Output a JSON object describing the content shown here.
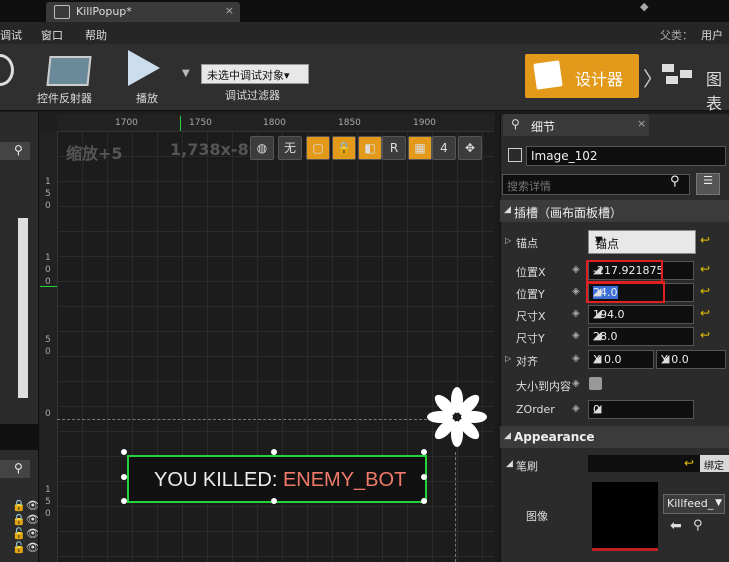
{
  "window": {
    "tab_title": "KillPopup*",
    "close_glyph": "×"
  },
  "menu": {
    "items": [
      "调试",
      "窗口",
      "帮助"
    ],
    "parent_label": "父类：",
    "parent_value": "用户"
  },
  "toolbar": {
    "widget_reflector": "控件反射器",
    "play": "播放",
    "debug_select": "未选中调试对象▾",
    "debug_filter": "调试过滤器",
    "designer": "设计器",
    "graph": "图表"
  },
  "canvas": {
    "ruler_ticks": [
      "1700",
      "1750",
      "1800",
      "1850",
      "1900"
    ],
    "left_ticks": [
      "1",
      "5",
      "0",
      "1",
      "0",
      "0",
      "5",
      "0",
      "0",
      "1",
      "5",
      "0"
    ],
    "zoom": "缩放+5",
    "coords": "1,738x-89",
    "btn_none": "无",
    "btn_r": "R",
    "btn_4": "4",
    "widget_prefix": "YOU KILLED: ",
    "widget_name": "ENEMY_BOT"
  },
  "details": {
    "tab_title": "细节",
    "name": "Image_102",
    "search_placeholder": "搜索详情",
    "slot_section": "插槽（画布面板槽）",
    "anchor_label": "锚点",
    "anchor_value": "锚点",
    "pos_x_label": "位置X",
    "pos_x_value": "-217.921875",
    "pos_y_label": "位置Y",
    "pos_y_value": "24.0",
    "size_x_label": "尺寸X",
    "size_x_value": "194.0",
    "size_y_label": "尺寸Y",
    "size_y_value": "28.0",
    "align_label": "对齐",
    "align_x": "X  0.0",
    "align_y": "Y  0.0",
    "autosize_label": "大小到内容",
    "zorder_label": "ZOrder",
    "zorder_value": "0",
    "appearance_section": "Appearance",
    "brush_label": "笔刷",
    "image_label": "图像",
    "brush_btn": "绑定",
    "texture_name": "Killfeed_"
  },
  "colors": {
    "accent": "#e39a1b",
    "selection": "#27d33a",
    "highlight_red": "#e02020",
    "reset_yellow": "#e6c200"
  }
}
